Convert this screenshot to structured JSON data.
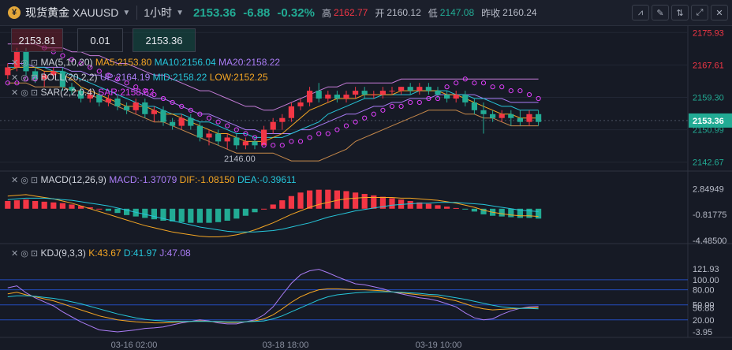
{
  "header": {
    "logo_char": "¥",
    "title": "现货黄金",
    "symbol": "XAUUSD",
    "timeframe": "1小时",
    "price": "2153.36",
    "change": "-6.88",
    "change_pct": "-0.32%",
    "high_label": "高",
    "high_value": "2162.77",
    "open_label": "开",
    "open_value": "2160.12",
    "low_label": "低",
    "low_value": "2147.08",
    "prev_close_label": "昨收",
    "prev_close_value": "2160.24"
  },
  "order_panel": {
    "sell_price": "2153.81",
    "lot": "0.01",
    "buy_price": "2153.36"
  },
  "main_legend": {
    "ma_name": "MA(5,10,20)",
    "ma5": "MA5:2153.80",
    "ma10": "MA10:2156.04",
    "ma20": "MA20:2158.22",
    "boll_name": "BOLL(20,2,2)",
    "boll_up": "UP:2164.19",
    "boll_mid": "MID:2158.22",
    "boll_low": "LOW:2152.25",
    "sar_name": "SAR(2,2,0.4)",
    "sar_value": "SAR:2158.62"
  },
  "main_axis": {
    "ticks": [
      "2175.93",
      "2167.61",
      "2159.30",
      "2150.99",
      "2142.67"
    ],
    "current": "2153.36",
    "low_marker": "2146.00"
  },
  "macd": {
    "name": "MACD(12,26,9)",
    "macd": "MACD:-1.37079",
    "dif": "DIF:-1.08150",
    "dea": "DEA:-0.39611",
    "ticks": [
      "2.84949",
      "-0.81775",
      "-4.48500"
    ]
  },
  "kdj": {
    "name": "KDJ(9,3,3)",
    "k": "K:43.67",
    "d": "D:41.97",
    "j": "J:47.08",
    "ticks": [
      "121.93",
      "100.00",
      "80.00",
      "50.00",
      "56.88",
      "20.00",
      "-3.95"
    ]
  },
  "time_axis": [
    "03-16 02:00",
    "03-18 18:00",
    "03-19 10:00"
  ],
  "colors": {
    "up": "#f23645",
    "down": "#22ab94",
    "ma5": "#f5a623",
    "ma10": "#26c6da",
    "ma20": "#ab7df6",
    "sar": "#e040fb"
  },
  "chart_data": [
    {
      "type": "candlestick",
      "title": "XAUUSD 1小时",
      "ylim": [
        2141,
        2177
      ],
      "candles": [
        [
          2165,
          2168,
          2164,
          2167
        ],
        [
          2167,
          2172,
          2166,
          2171
        ],
        [
          2171,
          2172,
          2165,
          2166
        ],
        [
          2166,
          2167,
          2163,
          2164
        ],
        [
          2164,
          2166,
          2162,
          2165
        ],
        [
          2165,
          2167,
          2164,
          2166
        ],
        [
          2166,
          2167,
          2161,
          2162
        ],
        [
          2162,
          2163,
          2160,
          2161
        ],
        [
          2161,
          2162,
          2158,
          2159
        ],
        [
          2159,
          2161,
          2158,
          2160
        ],
        [
          2160,
          2161,
          2157,
          2158
        ],
        [
          2158,
          2160,
          2157,
          2159
        ],
        [
          2159,
          2160,
          2156,
          2157
        ],
        [
          2157,
          2158,
          2155,
          2156
        ],
        [
          2156,
          2159,
          2155,
          2158
        ],
        [
          2158,
          2159,
          2154,
          2155
        ],
        [
          2155,
          2157,
          2153,
          2156
        ],
        [
          2156,
          2157,
          2152,
          2153
        ],
        [
          2153,
          2154,
          2151,
          2152
        ],
        [
          2152,
          2155,
          2151,
          2154
        ],
        [
          2154,
          2155,
          2151,
          2152
        ],
        [
          2152,
          2153,
          2148,
          2149
        ],
        [
          2149,
          2151,
          2147,
          2150
        ],
        [
          2150,
          2151,
          2147,
          2148
        ],
        [
          2148,
          2150,
          2146,
          2149
        ],
        [
          2149,
          2150,
          2146,
          2147
        ],
        [
          2147,
          2149,
          2146,
          2148
        ],
        [
          2148,
          2149,
          2146,
          2147
        ],
        [
          2147,
          2152,
          2147,
          2151
        ],
        [
          2151,
          2154,
          2150,
          2153
        ],
        [
          2153,
          2155,
          2151,
          2154
        ],
        [
          2154,
          2158,
          2153,
          2157
        ],
        [
          2157,
          2159,
          2156,
          2158
        ],
        [
          2158,
          2162,
          2157,
          2161
        ],
        [
          2161,
          2163,
          2158,
          2159
        ],
        [
          2159,
          2161,
          2158,
          2160
        ],
        [
          2160,
          2161,
          2158,
          2159
        ],
        [
          2159,
          2161,
          2158,
          2160
        ],
        [
          2160,
          2162,
          2159,
          2161
        ],
        [
          2161,
          2162,
          2159,
          2160
        ],
        [
          2160,
          2161,
          2159,
          2160
        ],
        [
          2160,
          2162,
          2159,
          2161
        ],
        [
          2161,
          2162,
          2160,
          2161
        ],
        [
          2161,
          2162,
          2160,
          2162
        ],
        [
          2162,
          2163,
          2160,
          2161
        ],
        [
          2161,
          2163,
          2160,
          2162
        ],
        [
          2162,
          2163,
          2160,
          2161
        ],
        [
          2161,
          2162,
          2159,
          2160
        ],
        [
          2160,
          2161,
          2158,
          2159
        ],
        [
          2159,
          2161,
          2158,
          2160
        ],
        [
          2160,
          2161,
          2157,
          2158
        ],
        [
          2158,
          2159,
          2155,
          2156
        ],
        [
          2156,
          2158,
          2150,
          2155
        ],
        [
          2155,
          2156,
          2153,
          2154
        ],
        [
          2154,
          2156,
          2153,
          2155
        ],
        [
          2155,
          2156,
          2152,
          2154
        ],
        [
          2154,
          2156,
          2152,
          2153
        ],
        [
          2153,
          2156,
          2152,
          2155
        ],
        [
          2155,
          2156,
          2152,
          2153
        ]
      ],
      "ma5": [
        2166,
        2167,
        2167,
        2167,
        2166,
        2166,
        2165,
        2164,
        2162,
        2161,
        2160,
        2159,
        2158,
        2157,
        2157,
        2157,
        2156,
        2155,
        2155,
        2154,
        2153,
        2152,
        2151,
        2150,
        2150,
        2149,
        2148,
        2148,
        2148,
        2149,
        2150,
        2152,
        2154,
        2156,
        2157,
        2158,
        2159,
        2159,
        2159,
        2160,
        2160,
        2160,
        2160,
        2161,
        2161,
        2161,
        2161,
        2161,
        2160,
        2160,
        2159,
        2158,
        2157,
        2156,
        2155,
        2155,
        2154,
        2154,
        2154
      ],
      "ma10": [
        2167,
        2167,
        2167,
        2167,
        2167,
        2166,
        2166,
        2165,
        2164,
        2163,
        2162,
        2161,
        2160,
        2159,
        2158,
        2157,
        2157,
        2156,
        2155,
        2155,
        2154,
        2153,
        2153,
        2152,
        2151,
        2150,
        2150,
        2149,
        2149,
        2149,
        2149,
        2150,
        2151,
        2152,
        2153,
        2155,
        2156,
        2157,
        2158,
        2159,
        2159,
        2160,
        2160,
        2160,
        2160,
        2161,
        2161,
        2161,
        2161,
        2160,
        2160,
        2159,
        2159,
        2158,
        2157,
        2157,
        2156,
        2156,
        2156
      ],
      "ma20": [
        2168,
        2168,
        2168,
        2167,
        2167,
        2167,
        2167,
        2166,
        2166,
        2165,
        2165,
        2164,
        2163,
        2162,
        2161,
        2160,
        2159,
        2159,
        2158,
        2157,
        2156,
        2155,
        2155,
        2154,
        2153,
        2152,
        2151,
        2151,
        2150,
        2150,
        2150,
        2150,
        2151,
        2151,
        2152,
        2153,
        2154,
        2155,
        2155,
        2156,
        2157,
        2157,
        2158,
        2158,
        2159,
        2159,
        2159,
        2160,
        2160,
        2160,
        2160,
        2160,
        2159,
        2159,
        2159,
        2158,
        2158,
        2158,
        2158
      ],
      "boll_up": [
        2173,
        2173,
        2173,
        2173,
        2172,
        2172,
        2172,
        2171,
        2171,
        2170,
        2170,
        2169,
        2168,
        2168,
        2167,
        2166,
        2165,
        2165,
        2164,
        2163,
        2162,
        2161,
        2161,
        2160,
        2159,
        2158,
        2157,
        2157,
        2156,
        2156,
        2157,
        2158,
        2159,
        2160,
        2161,
        2162,
        2162,
        2163,
        2163,
        2163,
        2163,
        2163,
        2163,
        2164,
        2164,
        2164,
        2164,
        2164,
        2164,
        2164,
        2164,
        2164,
        2164,
        2164,
        2164,
        2164,
        2164,
        2164,
        2164
      ],
      "boll_low": [
        2163,
        2163,
        2163,
        2162,
        2162,
        2162,
        2162,
        2161,
        2161,
        2160,
        2159,
        2158,
        2157,
        2156,
        2155,
        2154,
        2153,
        2153,
        2152,
        2151,
        2150,
        2149,
        2148,
        2147,
        2146,
        2145,
        2145,
        2145,
        2145,
        2145,
        2144,
        2143,
        2143,
        2143,
        2143,
        2144,
        2145,
        2146,
        2148,
        2149,
        2150,
        2151,
        2152,
        2153,
        2154,
        2155,
        2156,
        2156,
        2156,
        2156,
        2155,
        2155,
        2154,
        2154,
        2153,
        2152,
        2152,
        2152,
        2152
      ],
      "sar": [
        2163,
        2163,
        2164,
        2164,
        2172,
        2171,
        2170,
        2169,
        2168,
        2167,
        2166,
        2165,
        2164,
        2163,
        2162,
        2161,
        2160,
        2159,
        2158,
        2157,
        2156,
        2155,
        2154,
        2153,
        2152,
        2151,
        2150,
        2149,
        2147,
        2147,
        2147,
        2148,
        2148,
        2149,
        2150,
        2150,
        2151,
        2152,
        2153,
        2154,
        2155,
        2156,
        2157,
        2157,
        2158,
        2158,
        2159,
        2159,
        2162,
        2163,
        2164,
        2163,
        2163,
        2162,
        2162,
        2161,
        2161,
        2160,
        2159
      ]
    },
    {
      "type": "bar",
      "title": "MACD(12,26,9)",
      "ylim": [
        -4.5,
        3.0
      ],
      "macd": [
        1.1,
        1.2,
        1.3,
        1.1,
        1.0,
        0.9,
        0.8,
        0.6,
        0.4,
        0.2,
        0.0,
        -0.3,
        -0.6,
        -0.9,
        -1.1,
        -1.3,
        -1.5,
        -1.7,
        -1.8,
        -1.9,
        -2.0,
        -2.0,
        -2.0,
        -1.9,
        -1.7,
        -1.4,
        -1.0,
        -0.5,
        0.0,
        0.6,
        1.2,
        1.8,
        2.3,
        2.6,
        2.7,
        2.7,
        2.6,
        2.5,
        2.3,
        2.1,
        1.9,
        1.7,
        1.5,
        1.3,
        1.1,
        0.9,
        0.7,
        0.5,
        0.3,
        0.1,
        -0.1,
        -0.4,
        -0.8,
        -1.0,
        -1.1,
        -1.2,
        -1.3,
        -1.3,
        -1.4
      ],
      "dif": [
        1.8,
        1.9,
        2.0,
        1.8,
        1.6,
        1.4,
        1.1,
        0.8,
        0.4,
        0.0,
        -0.4,
        -0.8,
        -1.2,
        -1.6,
        -2.0,
        -2.4,
        -2.7,
        -3.0,
        -3.3,
        -3.5,
        -3.7,
        -3.9,
        -4.0,
        -4.0,
        -3.9,
        -3.7,
        -3.4,
        -3.0,
        -2.5,
        -2.0,
        -1.4,
        -0.8,
        -0.3,
        0.2,
        0.6,
        0.9,
        1.2,
        1.4,
        1.5,
        1.6,
        1.6,
        1.6,
        1.6,
        1.5,
        1.5,
        1.4,
        1.3,
        1.2,
        1.0,
        0.8,
        0.5,
        0.2,
        -0.2,
        -0.5,
        -0.7,
        -0.9,
        -1.0,
        -1.0,
        -1.1
      ],
      "dea": [
        1.3,
        1.4,
        1.5,
        1.5,
        1.5,
        1.4,
        1.3,
        1.2,
        1.0,
        0.8,
        0.6,
        0.4,
        0.1,
        -0.2,
        -0.5,
        -0.8,
        -1.1,
        -1.4,
        -1.7,
        -2.0,
        -2.3,
        -2.6,
        -2.8,
        -3.0,
        -3.2,
        -3.3,
        -3.3,
        -3.3,
        -3.2,
        -3.1,
        -2.9,
        -2.6,
        -2.3,
        -2.0,
        -1.6,
        -1.2,
        -0.9,
        -0.6,
        -0.3,
        -0.1,
        0.1,
        0.3,
        0.5,
        0.6,
        0.7,
        0.8,
        0.8,
        0.9,
        0.9,
        0.9,
        0.8,
        0.7,
        0.6,
        0.4,
        0.2,
        0.0,
        -0.2,
        -0.3,
        -0.4
      ]
    },
    {
      "type": "line",
      "title": "KDJ(9,3,3)",
      "ylim": [
        -3.95,
        121.93
      ],
      "k": [
        72,
        75,
        70,
        66,
        62,
        58,
        52,
        46,
        40,
        34,
        28,
        24,
        20,
        18,
        16,
        15,
        14,
        14,
        15,
        16,
        17,
        18,
        17,
        16,
        15,
        15,
        16,
        18,
        22,
        30,
        42,
        55,
        66,
        74,
        80,
        82,
        82,
        81,
        80,
        80,
        79,
        78,
        76,
        74,
        72,
        70,
        68,
        66,
        62,
        58,
        52,
        46,
        42,
        40,
        41,
        42,
        43,
        44,
        44
      ],
      "d": [
        66,
        68,
        68,
        67,
        65,
        63,
        60,
        56,
        52,
        47,
        42,
        37,
        32,
        28,
        24,
        21,
        19,
        18,
        17,
        17,
        17,
        17,
        17,
        17,
        16,
        16,
        16,
        17,
        18,
        22,
        28,
        36,
        44,
        52,
        60,
        66,
        70,
        72,
        74,
        75,
        76,
        76,
        76,
        75,
        74,
        73,
        71,
        70,
        67,
        64,
        61,
        57,
        53,
        49,
        46,
        44,
        43,
        43,
        42
      ],
      "j": [
        84,
        88,
        74,
        64,
        56,
        48,
        36,
        26,
        16,
        8,
        0,
        -2,
        -4,
        -2,
        0,
        3,
        4,
        6,
        10,
        14,
        17,
        20,
        18,
        14,
        12,
        12,
        16,
        20,
        30,
        46,
        70,
        93,
        110,
        118,
        121,
        114,
        106,
        99,
        92,
        90,
        86,
        82,
        76,
        72,
        68,
        64,
        62,
        58,
        52,
        46,
        34,
        24,
        20,
        22,
        31,
        38,
        43,
        46,
        47
      ]
    }
  ]
}
